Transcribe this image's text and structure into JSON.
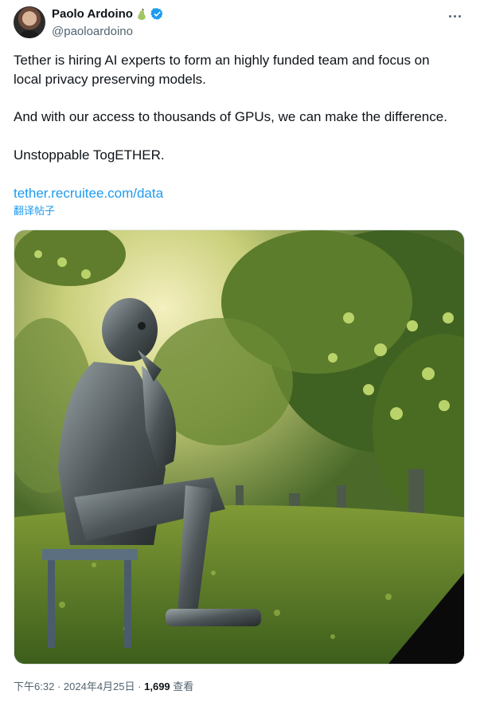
{
  "author": {
    "name": "Paolo Ardoino",
    "handle": "@paoloardoino",
    "avatar_icon": "avatar",
    "badge_emoji": "pear-icon",
    "verified_icon": "verified-badge-icon"
  },
  "tweet": {
    "lines": [
      "Tether is hiring AI experts to form an highly funded team and focus on",
      "local privacy preserving models.",
      "And with our access to thousands of GPUs, we can make the difference.",
      "Unstoppable TogETHER."
    ],
    "link": "tether.recruitee.com/data",
    "translate_label": "翻译帖子"
  },
  "media": {
    "subject": "robot-thinker-in-orchard"
  },
  "meta": {
    "time": "下午6:32",
    "separator": "·",
    "date": "2024年4月25日",
    "views_count": "1,699",
    "views_label": "查看"
  },
  "colors": {
    "accent": "#1d9bf0",
    "secondary_text": "#536471",
    "primary_text": "#0f1419"
  }
}
